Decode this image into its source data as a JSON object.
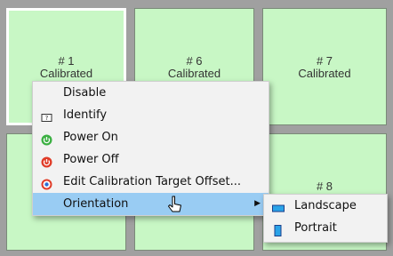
{
  "tiles": [
    {
      "num": "# 1",
      "status": "Calibrated"
    },
    {
      "num": "# 6",
      "status": "Calibrated"
    },
    {
      "num": "# 7",
      "status": "Calibrated"
    },
    {
      "num": "",
      "status": ""
    },
    {
      "num": "",
      "status": ""
    },
    {
      "num": "# 8",
      "status": ""
    }
  ],
  "context_menu": {
    "items": [
      {
        "label": "Disable",
        "icon": ""
      },
      {
        "label": "Identify",
        "icon": "identify-icon"
      },
      {
        "label": "Power On",
        "icon": "power-on-icon"
      },
      {
        "label": "Power Off",
        "icon": "power-off-icon"
      },
      {
        "label": "Edit Calibration Target Offset...",
        "icon": "target-icon"
      },
      {
        "label": "Orientation",
        "icon": "",
        "submenu_arrow": "▶"
      }
    ]
  },
  "submenu": {
    "items": [
      {
        "label": "Landscape",
        "icon": "landscape-icon"
      },
      {
        "label": "Portrait",
        "icon": "portrait-icon"
      }
    ]
  },
  "colors": {
    "tile": "#c8f7c5",
    "background": "#a0a0a0",
    "highlight": "#99ccf3",
    "power_on": "#3cb043",
    "power_off": "#e03c28"
  }
}
